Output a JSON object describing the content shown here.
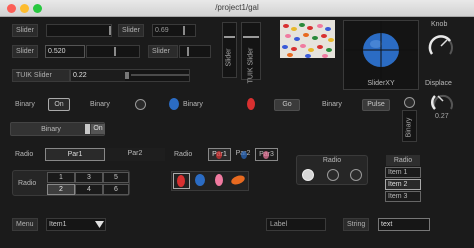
{
  "window": {
    "title": "/project1/gal"
  },
  "sliders": [
    {
      "label": "Slider",
      "value": "",
      "level": 0.95
    },
    {
      "label": "Slider",
      "value": "0.69",
      "level": 0.69
    },
    {
      "label": "Slider",
      "value": "0.520",
      "level": 0.52
    },
    {
      "label": "Slider",
      "value": "",
      "level": 0.5
    },
    {
      "label": "TUIK Slider",
      "value": "0.22",
      "level": 0.22
    }
  ],
  "vsliders": [
    {
      "label": "Slider",
      "level": 0.3
    },
    {
      "label": "TUIK Slider",
      "level": 0.3
    }
  ],
  "sliderxy": {
    "label": "SliderXY"
  },
  "knob": {
    "label": "Knob",
    "level": 0.8
  },
  "displace": {
    "label": "Displace",
    "value": "0.27",
    "level": 0.27
  },
  "binary": [
    {
      "label": "Binary",
      "state": "On"
    },
    {
      "label": "Binary"
    },
    {
      "label": "Binary"
    }
  ],
  "go": {
    "label": "Go"
  },
  "pulse": {
    "label": "Binary",
    "state": "Pulse"
  },
  "vbinary": {
    "label": "Binary"
  },
  "toggle": {
    "label": "Binary",
    "state": "On"
  },
  "radio1": {
    "label": "Radio",
    "options": [
      "Par1",
      "Par2"
    ]
  },
  "radio2": {
    "label": "Radio",
    "options": [
      "Par1",
      "Par2",
      "Par3"
    ]
  },
  "radio3": {
    "label": "Radio",
    "grid": [
      "1",
      "3",
      "5",
      "2",
      "4",
      "6"
    ]
  },
  "radio4": {
    "label": "Radio"
  },
  "radio5": {
    "label": "Radio",
    "items": [
      "Item 1",
      "Item 2",
      "Item 3"
    ]
  },
  "menu": {
    "label": "Menu",
    "value": "Item1"
  },
  "labelfield": {
    "label": "Label"
  },
  "stringfield": {
    "label": "String",
    "value": "text"
  }
}
